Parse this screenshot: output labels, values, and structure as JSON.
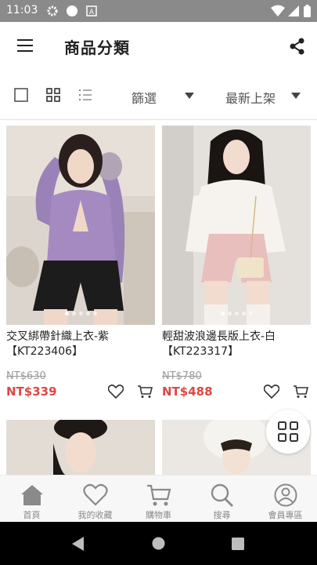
{
  "status_bar": {
    "time": "11:03",
    "icons": [
      "settings-icon",
      "circle-icon",
      "a-icon",
      "wifi-icon",
      "signal-icon",
      "battery-icon"
    ]
  },
  "app_bar": {
    "title": "商品分類",
    "icons": [
      "menu-icon",
      "share-icon"
    ]
  },
  "toolbar": {
    "view_icons": [
      "checkbox-icon",
      "grid-view-icon",
      "list-view-icon"
    ],
    "filter_label": "篩選",
    "sort_label": "最新上架"
  },
  "products": [
    {
      "name": "交叉綁帶針織上衣-紫【KT223406】",
      "original_price": "NT$630",
      "price": "NT$339",
      "image": "model-in-purple-knit-top-and-black-shorts"
    },
    {
      "name": "輕甜波浪邊長版上衣-白【KT223317】",
      "original_price": "NT$780",
      "price": "NT$488",
      "image": "model-in-white-blouse-and-pink-shorts"
    }
  ],
  "bottom_nav": {
    "items": [
      {
        "label": "首頁",
        "icon": "home-icon"
      },
      {
        "label": "我的收藏",
        "icon": "heart-icon"
      },
      {
        "label": "購物車",
        "icon": "cart-icon"
      },
      {
        "label": "搜尋",
        "icon": "search-icon"
      },
      {
        "label": "會員專區",
        "icon": "member-icon"
      }
    ]
  },
  "colors": {
    "price_red": "#e04545",
    "status_bar": "#8a8a8a",
    "nav_grey": "#8a8a8a"
  }
}
